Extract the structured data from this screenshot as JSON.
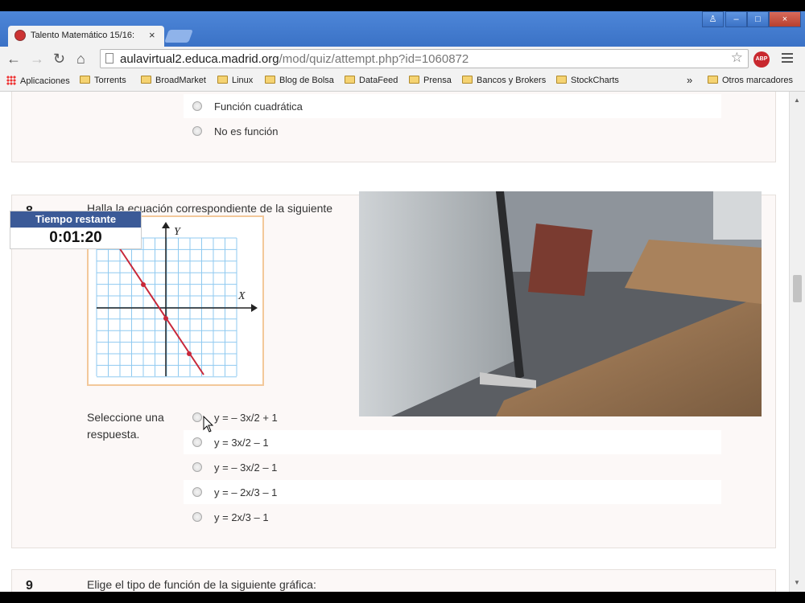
{
  "browser": {
    "tab_title": "Talento Matemático 15/16:",
    "tab_close": "×",
    "url_host": "aulavirtual2.educa.madrid.org",
    "url_path": "/mod/quiz/attempt.php?id=1060872",
    "abp_label": "ABP",
    "window_controls": {
      "user": "♙",
      "minimize": "‒",
      "maximize": "□",
      "close": "×"
    }
  },
  "nav": {
    "back": "←",
    "forward": "→",
    "reload": "↻",
    "home": "⌂",
    "star": "☆"
  },
  "bookmarks": {
    "apps": "Aplicaciones",
    "items": [
      "Torrents",
      "BroadMarket",
      "Linux",
      "Blog de Bolsa",
      "DataFeed",
      "Prensa",
      "Bancos y Brokers",
      "StockCharts"
    ],
    "more": "»",
    "other": "Otros marcadores"
  },
  "prev_question": {
    "options": [
      "Función cuadrática",
      "No es función"
    ]
  },
  "question8": {
    "number": "8",
    "text": "Halla la ecuación correspondiente de la siguiente",
    "select_prompt_1": "Seleccione una",
    "select_prompt_2": "respuesta.",
    "options": [
      "y = – 3x/2 + 1",
      "y = 3x/2 – 1",
      "y = – 3x/2 – 1",
      "y = – 2x/3 – 1",
      "y = 2x/3 – 1"
    ],
    "graph": {
      "x_axis_label": "X",
      "y_axis_label": "Y"
    }
  },
  "timer": {
    "label": "Tiempo restante",
    "value": "0:01:20"
  },
  "question9": {
    "number": "9",
    "text": "Elige el tipo de función de la siguiente gráfica:"
  },
  "colors": {
    "timer_header": "#3b5a97",
    "graph_line": "#c8283a",
    "graph_grid": "#8fcaf0",
    "graph_border": "#f3c89a"
  }
}
